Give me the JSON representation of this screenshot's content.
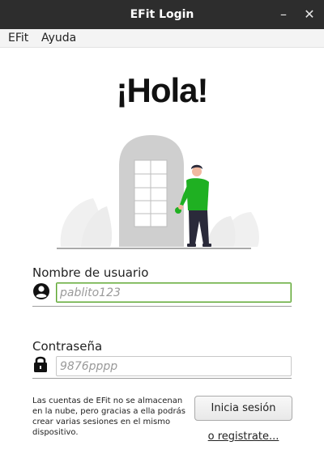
{
  "window": {
    "title": "EFit Login",
    "minimize_icon": "minimize-icon",
    "close_icon": "close-icon"
  },
  "menu": {
    "items": [
      {
        "label": "EFit"
      },
      {
        "label": "Ayuda"
      }
    ]
  },
  "greeting": "¡Hola!",
  "illustration": {
    "icon": "person-at-door-illustration",
    "accent_color": "#1fb022"
  },
  "username": {
    "label": "Nombre de usuario",
    "placeholder": "pablito123",
    "value": "",
    "icon": "user-circle-icon"
  },
  "password": {
    "label": "Contraseña",
    "placeholder": "9876pppp",
    "value": "",
    "icon": "lock-icon"
  },
  "note": "Las cuentas de EFit no se almacenan en la nube, pero gracias a ella podrás crear varias sesiones en el mismo dispositivo.",
  "actions": {
    "login_label": "Inicia sesión",
    "register_label": "o registrate..."
  },
  "colors": {
    "titlebar": "#2d2d2d",
    "focus_border": "#5aa32e"
  }
}
